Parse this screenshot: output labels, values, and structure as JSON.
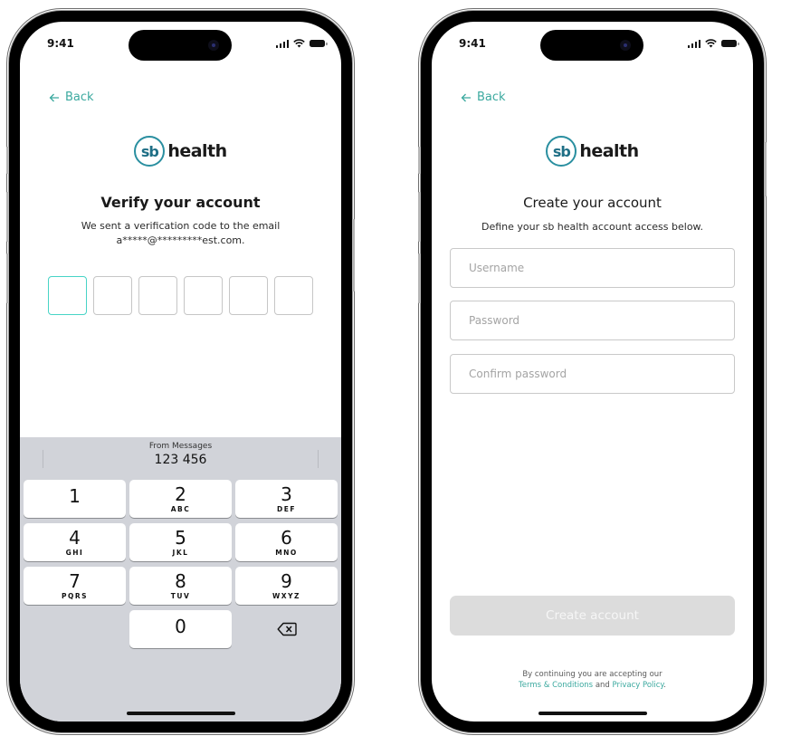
{
  "status_bar": {
    "time": "9:41"
  },
  "colors": {
    "accent": "#3ba99f",
    "otp_active_border": "#47d4c6",
    "logo_ring": "#2a8fa0",
    "button_disabled_bg": "#dcdcdc",
    "keyboard_bg": "#d1d3d9"
  },
  "brand": {
    "mark": "sb",
    "word": "health"
  },
  "verify_screen": {
    "back_label": "Back",
    "title": "Verify your account",
    "subtitle_line1": "We sent a verification code to the email",
    "subtitle_line2": "a*****@*********est.com.",
    "otp_length": 6,
    "otp_values": [
      "",
      "",
      "",
      "",
      "",
      ""
    ],
    "keyboard": {
      "suggestion_source": "From Messages",
      "suggestion_code": "123 456",
      "keys": [
        {
          "num": "1",
          "letters": ""
        },
        {
          "num": "2",
          "letters": "ABC"
        },
        {
          "num": "3",
          "letters": "DEF"
        },
        {
          "num": "4",
          "letters": "GHI"
        },
        {
          "num": "5",
          "letters": "JKL"
        },
        {
          "num": "6",
          "letters": "MNO"
        },
        {
          "num": "7",
          "letters": "PQRS"
        },
        {
          "num": "8",
          "letters": "TUV"
        },
        {
          "num": "9",
          "letters": "WXYZ"
        },
        {
          "num": "0",
          "letters": ""
        }
      ],
      "delete_icon": "backspace-icon"
    }
  },
  "create_screen": {
    "back_label": "Back",
    "title": "Create your account",
    "subtitle": "Define your sb health account access below.",
    "fields": [
      {
        "name": "username",
        "placeholder": "Username",
        "value": ""
      },
      {
        "name": "password",
        "placeholder": "Password",
        "value": ""
      },
      {
        "name": "confirm-password",
        "placeholder": "Confirm password",
        "value": ""
      }
    ],
    "submit_label": "Create account",
    "submit_enabled": false,
    "legal_prefix": "By continuing you are accepting our",
    "terms_link": "Terms & Conditions",
    "legal_and": "and",
    "privacy_link": "Privacy Policy",
    "legal_suffix": "."
  }
}
